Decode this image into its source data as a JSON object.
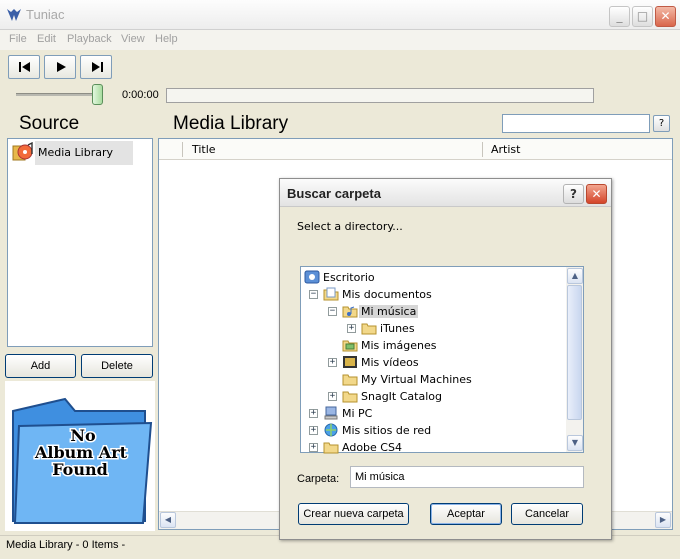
{
  "window": {
    "title": "Tuniac",
    "minimize": "_",
    "maximize": "□",
    "close": "✕"
  },
  "menu": [
    "File",
    "Edit",
    "Playback",
    "View",
    "Help"
  ],
  "player": {
    "time": "0:00:00",
    "volume_fraction": 0.92,
    "seek_fraction": 0.0
  },
  "source": {
    "heading": "Source",
    "items": [
      {
        "label": "Media Library",
        "selected": true
      }
    ],
    "add_label": "Add",
    "delete_label": "Delete"
  },
  "album_art": {
    "text": [
      "No",
      "Album Art",
      "Found"
    ]
  },
  "library": {
    "heading": "Media Library",
    "search_value": "",
    "help_label": "?",
    "columns": [
      "Title",
      "Artist"
    ]
  },
  "status": {
    "text": "Media Library - 0 Items -"
  },
  "dialog": {
    "title": "Buscar carpeta",
    "help_label": "?",
    "close_label": "✕",
    "prompt": "Select a directory...",
    "tree": [
      {
        "label": "Escritorio",
        "depth": 0,
        "expander": "",
        "icon": "desktop-icon"
      },
      {
        "label": "Mis documentos",
        "depth": 1,
        "expander": "−",
        "icon": "documents-folder-icon"
      },
      {
        "label": "Mi música",
        "depth": 2,
        "expander": "−",
        "icon": "music-folder-icon",
        "selected": true
      },
      {
        "label": "iTunes",
        "depth": 3,
        "expander": "+",
        "icon": "folder-icon"
      },
      {
        "label": "Mis imágenes",
        "depth": 2,
        "expander": "",
        "icon": "pictures-folder-icon"
      },
      {
        "label": "Mis vídeos",
        "depth": 2,
        "expander": "+",
        "icon": "videos-folder-icon"
      },
      {
        "label": "My Virtual Machines",
        "depth": 2,
        "expander": "",
        "icon": "folder-icon"
      },
      {
        "label": "SnagIt Catalog",
        "depth": 2,
        "expander": "+",
        "icon": "folder-icon"
      },
      {
        "label": "Mi PC",
        "depth": 1,
        "expander": "+",
        "icon": "computer-icon"
      },
      {
        "label": "Mis sitios de red",
        "depth": 1,
        "expander": "+",
        "icon": "network-icon"
      },
      {
        "label": "Adobe CS4",
        "depth": 1,
        "expander": "+",
        "icon": "folder-icon"
      }
    ],
    "folder_label": "Carpeta:",
    "folder_value": "Mi música",
    "new_folder_label": "Crear nueva carpeta",
    "ok_label": "Aceptar",
    "cancel_label": "Cancelar"
  }
}
